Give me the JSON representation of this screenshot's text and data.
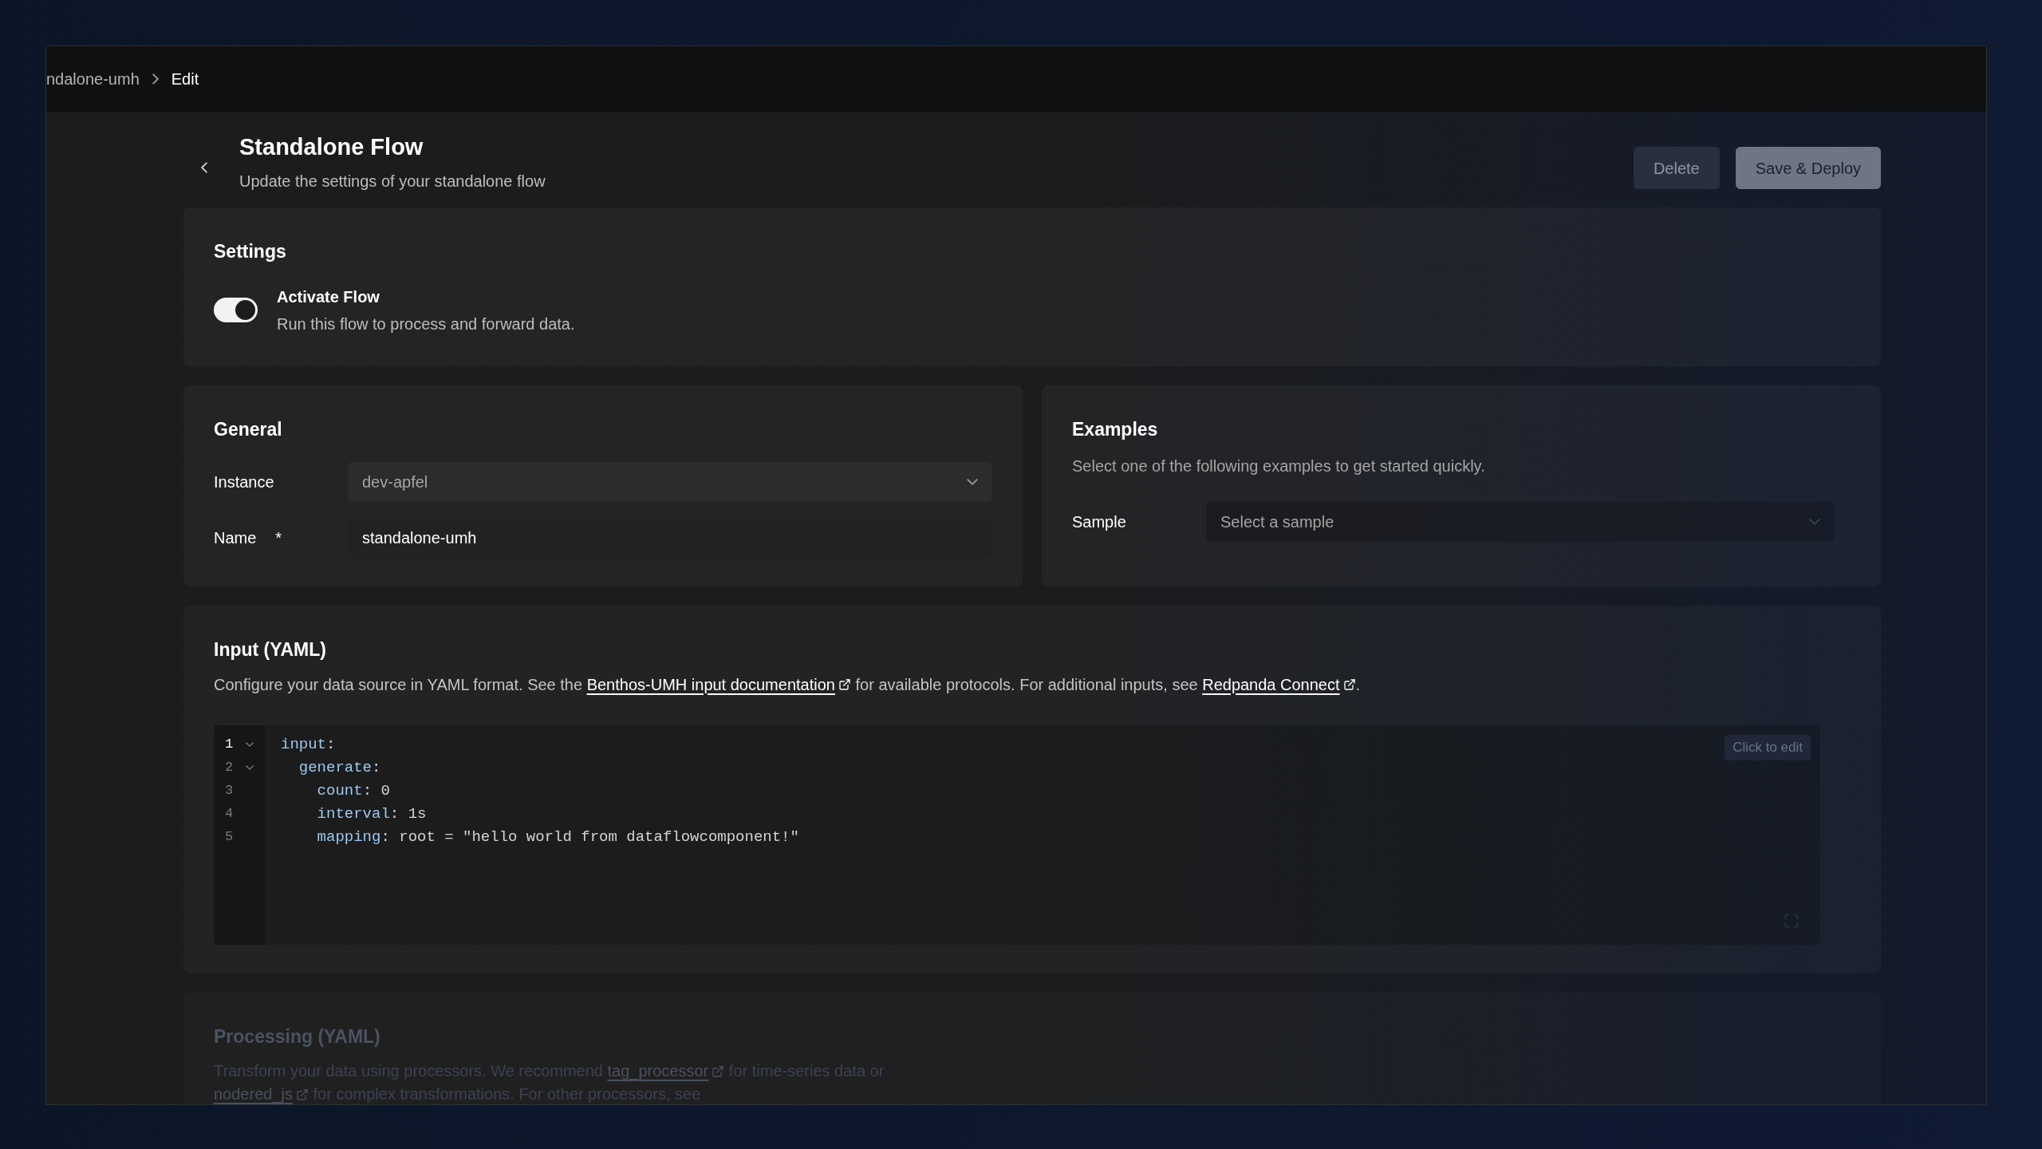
{
  "breadcrumb": [
    {
      "label": "ndalone-umh",
      "current": false
    },
    {
      "label": "Edit",
      "current": true
    }
  ],
  "header": {
    "title": "Standalone Flow",
    "subtitle": "Update the settings of your standalone flow",
    "buttons": [
      {
        "label": "Delete",
        "kind": "secondary"
      },
      {
        "label": "Save & Deploy",
        "kind": "primary"
      }
    ]
  },
  "settings": {
    "title": "Settings",
    "toggle": {
      "label": "Activate Flow",
      "description": "Run this flow to process and forward data.",
      "on": true
    }
  },
  "general": {
    "title": "General",
    "fields": [
      {
        "label": "Instance",
        "kind": "select",
        "value": "dev-apfel"
      },
      {
        "label": "Name",
        "kind": "text",
        "required_mark": "*",
        "value": "standalone-umh"
      }
    ]
  },
  "examples": {
    "title": "Examples",
    "description": "Select one of the following examples to get started quickly.",
    "field": {
      "label": "Sample",
      "placeholder": "Select a sample"
    }
  },
  "input": {
    "title": "Input (YAML)",
    "description": [
      {
        "kind": "text",
        "text": "Configure your data source in YAML format. See the "
      },
      {
        "kind": "link",
        "text": "Benthos-UMH input documentation"
      },
      {
        "kind": "text",
        "text": " for available protocols. For additional inputs, see "
      },
      {
        "kind": "link",
        "text": "Redpanda Connect"
      },
      {
        "kind": "text",
        "text": "."
      }
    ],
    "editor": {
      "edit_button": "Click to edit",
      "lines": [
        {
          "number": "1",
          "active": true,
          "foldable": true,
          "key": "input",
          "rest": ":"
        },
        {
          "number": "2",
          "active": false,
          "foldable": true,
          "key": "  generate",
          "rest": ":"
        },
        {
          "number": "3",
          "active": false,
          "foldable": false,
          "key": "    count",
          "rest": ": 0"
        },
        {
          "number": "4",
          "active": false,
          "foldable": false,
          "key": "    interval",
          "rest": ": 1s"
        },
        {
          "number": "5",
          "active": false,
          "foldable": false,
          "key": "    mapping",
          "rest": ": root = \"hello world from dataflowcomponent!\""
        }
      ]
    }
  },
  "processing": {
    "title": "Processing (YAML)",
    "description": [
      {
        "kind": "text",
        "text": "Transform your data using processors. We recommend "
      },
      {
        "kind": "link",
        "text": "tag_processor"
      },
      {
        "kind": "text",
        "text": " for time-series data or "
      },
      {
        "kind": "link",
        "text": "nodered_js"
      },
      {
        "kind": "text",
        "text": " for complex transformations. For other processors, see"
      }
    ]
  }
}
